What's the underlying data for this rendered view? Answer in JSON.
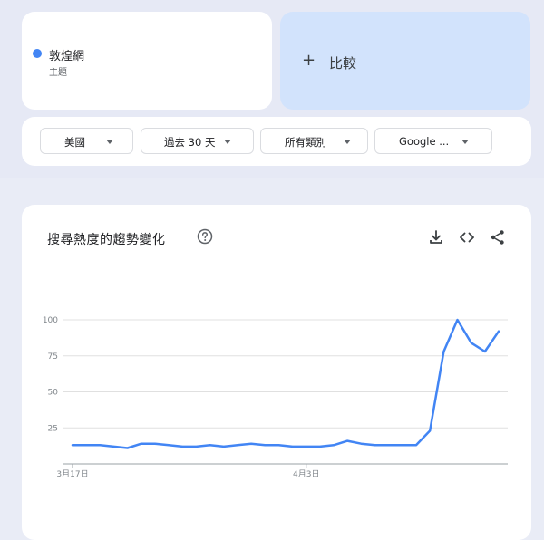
{
  "term": {
    "name": "敦煌網",
    "type": "主題",
    "color": "#4285f4"
  },
  "compare": {
    "label": "比較"
  },
  "filters": {
    "region": "美國",
    "period": "過去 30 天",
    "category": "所有類別",
    "source": "Google ..."
  },
  "chart": {
    "title": "搜尋熱度的趨勢變化"
  },
  "chart_data": {
    "type": "line",
    "title": "搜尋熱度的趨勢變化",
    "xlabel": "",
    "ylabel": "",
    "ylim": [
      0,
      100
    ],
    "yticks": [
      25,
      50,
      75,
      100
    ],
    "x_tick_labels": [
      {
        "label": "3月17日",
        "index": 0
      },
      {
        "label": "4月3日",
        "index": 17
      }
    ],
    "grid": true,
    "legend": "none",
    "series": [
      {
        "color": "#4285f4",
        "values": [
          13,
          13,
          13,
          12,
          11,
          14,
          14,
          13,
          12,
          12,
          13,
          12,
          13,
          14,
          13,
          13,
          12,
          12,
          12,
          13,
          16,
          14,
          13,
          13,
          13,
          13,
          23,
          78,
          100,
          84,
          78,
          92
        ]
      }
    ]
  }
}
